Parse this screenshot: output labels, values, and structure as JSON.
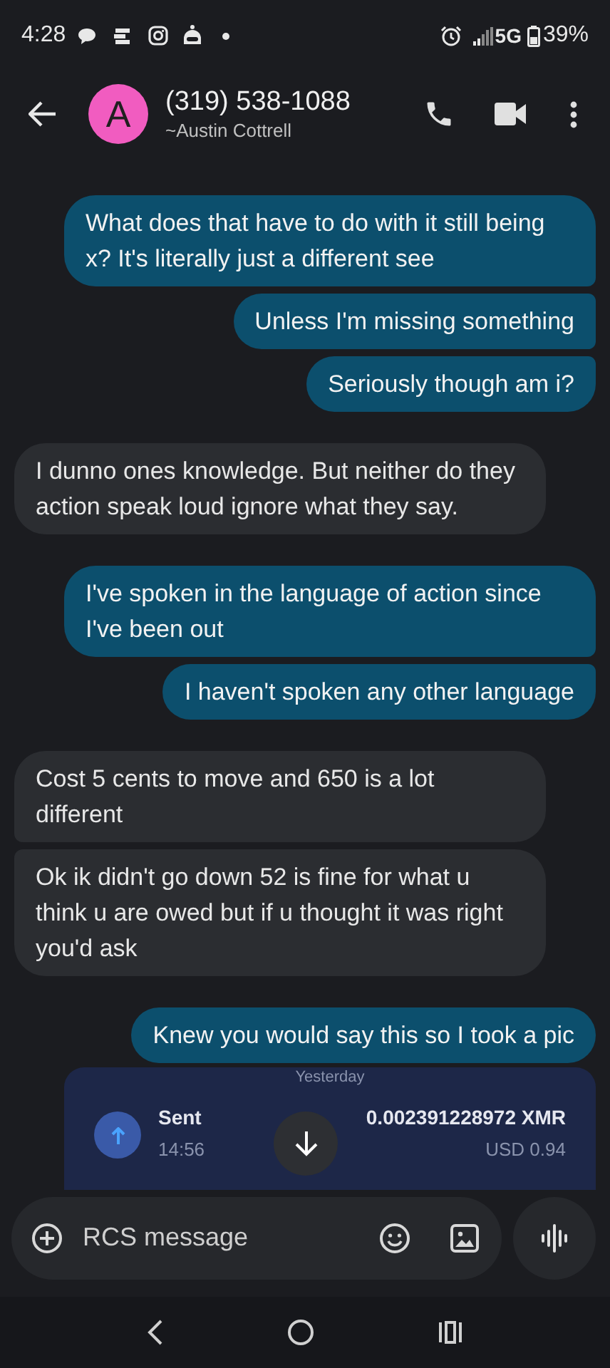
{
  "status_bar": {
    "time": "4:28",
    "network": "5G",
    "battery": "39%"
  },
  "header": {
    "avatar_letter": "A",
    "title": "(319) 538-1088",
    "subtitle": "~Austin Cottrell"
  },
  "messages": [
    {
      "kind": "out",
      "text": "What does that have to do with it still being x? It's literally just a different see"
    },
    {
      "kind": "out",
      "text": "Unless I'm missing something"
    },
    {
      "kind": "out",
      "text": "Seriously though am i?"
    },
    {
      "kind": "in",
      "text": "I dunno ones knowledge. But neither do they action speak loud ignore what they say."
    },
    {
      "kind": "out",
      "text": "I've spoken in the language of action since I've been out"
    },
    {
      "kind": "out",
      "text": "I haven't spoken any other language"
    },
    {
      "kind": "in",
      "text": "Cost 5 cents to move and 650 is a lot different"
    },
    {
      "kind": "in",
      "text": "Ok ik didn't go down 52 is fine for what u think u are owed but if u thought it was right you'd ask"
    },
    {
      "kind": "out",
      "text": "Knew you would say this so I took a pic"
    }
  ],
  "attachment": {
    "date": "Yesterday",
    "label": "Sent",
    "time": "14:56",
    "amount": "0.002391228972 XMR",
    "fiat": "USD 0.94"
  },
  "composer": {
    "placeholder": "RCS message"
  }
}
